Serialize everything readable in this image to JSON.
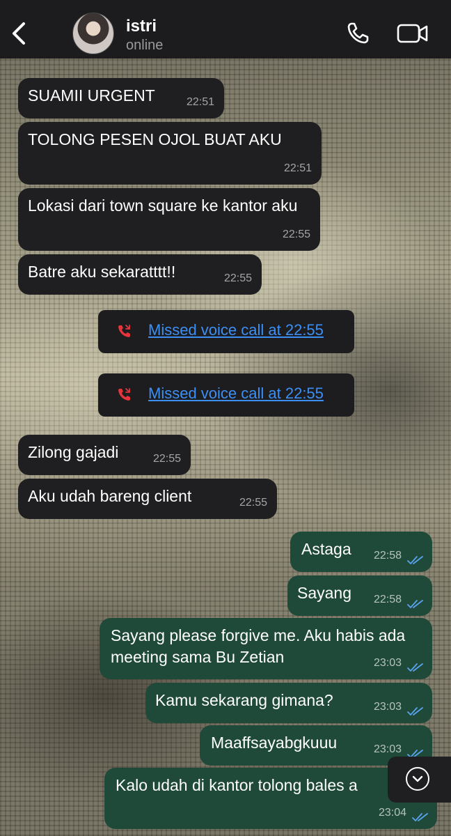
{
  "header": {
    "back_icon": "chevron-left-icon",
    "contact_name": "istri",
    "status": "online",
    "voice_call_icon": "phone-icon",
    "video_call_icon": "video-camera-icon"
  },
  "messages": [
    {
      "dir": "in",
      "text": "SUAMII URGENT",
      "time": "22:51"
    },
    {
      "dir": "in",
      "text": "TOLONG PESEN OJOL BUAT AKU",
      "time": "22:51"
    },
    {
      "dir": "in",
      "text": "Lokasi dari town square ke kantor aku",
      "time": "22:55"
    },
    {
      "dir": "in",
      "text": "Batre aku sekaratttt!!",
      "time": "22:55"
    },
    {
      "dir": "in",
      "text": "Zilong gajadi",
      "time": "22:55"
    },
    {
      "dir": "in",
      "text": "Aku udah bareng client",
      "time": "22:55"
    },
    {
      "dir": "out",
      "text": "Astaga",
      "time": "22:58",
      "status": "read"
    },
    {
      "dir": "out",
      "text": "Sayang",
      "time": "22:58",
      "status": "read"
    },
    {
      "dir": "out",
      "text": "Sayang please forgive me. Aku habis ada meeting sama Bu Zetian",
      "time": "23:03",
      "status": "read"
    },
    {
      "dir": "out",
      "text": "Kamu sekarang gimana?",
      "time": "23:03",
      "status": "read"
    },
    {
      "dir": "out",
      "text": "Maaffsayabgkuuu",
      "time": "23:03",
      "status": "read"
    },
    {
      "dir": "out",
      "text": "Kalo udah di kantor tolong bales a",
      "time": "23:04",
      "status": "read"
    }
  ],
  "calls": [
    {
      "text": "Missed voice call at 22:55",
      "icon": "missed-call-icon",
      "color": "#e5343b"
    },
    {
      "text": "Missed voice call at 22:55",
      "icon": "missed-call-icon",
      "color": "#e5343b"
    }
  ],
  "scroll_button": {
    "icon": "chevron-down-circle-icon"
  },
  "colors": {
    "outgoing": "#1f4a39",
    "incoming": "#1f1f21",
    "link": "#3b8ff5",
    "read_ticks": "#5aa3f0"
  }
}
